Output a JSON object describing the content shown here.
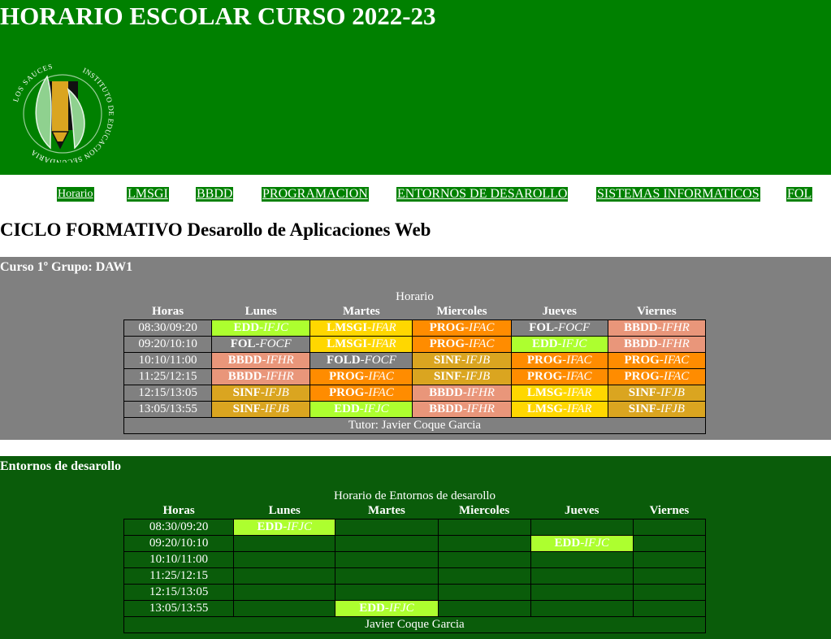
{
  "header": {
    "title": "HORARIO ESCOLAR CURSO 2022-23",
    "logo": {
      "text_top": "LOS SAUCES",
      "text_ring": "INSTITUTO DE EDUCACION SECUNDARIA"
    }
  },
  "nav": [
    "Horario",
    "LMSGI",
    "BBDD",
    "PROGRAMACION",
    "ENTORNOS DE DESAROLLO",
    "SISTEMAS INFORMATICOS",
    "FOL"
  ],
  "ciclo": "CICLO FORMATIVO Desarollo de Aplicaciones Web",
  "grupo": {
    "title": "Curso 1º Grupo: DAW1",
    "caption": "Horario",
    "headers": [
      "Horas",
      "Lunes",
      "Martes",
      "Miercoles",
      "Jueves",
      "Viernes"
    ],
    "rows": [
      {
        "time": "08:30/09:20",
        "cells": [
          [
            "EDD",
            "-IFJC",
            "edd"
          ],
          [
            "LMSGI",
            "-IFAR",
            "lmsgi"
          ],
          [
            "PROG",
            "-IFAC",
            "prog"
          ],
          [
            "FOL",
            "-FOCF",
            "fol"
          ],
          [
            "BBDD",
            "-IFHR",
            "bbdd"
          ]
        ]
      },
      {
        "time": "09:20/10:10",
        "cells": [
          [
            "FOL",
            "-FOCF",
            "fol"
          ],
          [
            "LMSGI",
            "-IFAR",
            "lmsgi"
          ],
          [
            "PROG",
            "-IFAC",
            "prog"
          ],
          [
            "EDD",
            "-IFJC",
            "edd"
          ],
          [
            "BBDD",
            "-IFHR",
            "bbdd"
          ]
        ]
      },
      {
        "time": "10:10/11:00",
        "cells": [
          [
            "BBDD",
            "-IFHR",
            "bbdd"
          ],
          [
            "FOLD",
            "-FOCF",
            "fol"
          ],
          [
            "SINF",
            "-IFJB",
            "sinf"
          ],
          [
            "PROG",
            "-IFAC",
            "prog"
          ],
          [
            "PROG",
            "-IFAC",
            "prog"
          ]
        ]
      },
      {
        "time": "11:25/12:15",
        "cells": [
          [
            "BBDD",
            "-IFHR",
            "bbdd"
          ],
          [
            "PROG",
            "-IFAC",
            "prog"
          ],
          [
            "SINF",
            "-IFJB",
            "sinf"
          ],
          [
            "PROG",
            "-IFAC",
            "prog"
          ],
          [
            "PROG",
            "-IFAC",
            "prog"
          ]
        ]
      },
      {
        "time": "12:15/13:05",
        "cells": [
          [
            "SINF",
            "-IFJB",
            "sinf"
          ],
          [
            "PROG",
            "-IFAC",
            "prog"
          ],
          [
            "BBDD",
            "-IFHR",
            "bbdd"
          ],
          [
            "LMSG",
            "-IFAR",
            "lmsgi"
          ],
          [
            "SINF",
            "-IFJB",
            "sinf"
          ]
        ]
      },
      {
        "time": "13:05/13:55",
        "cells": [
          [
            "SINF",
            "-IFJB",
            "sinf"
          ],
          [
            "EDD",
            "-IFJC",
            "edd"
          ],
          [
            "BBDD",
            "-IFHR",
            "bbdd"
          ],
          [
            "LMSG",
            "-IFAR",
            "lmsgi"
          ],
          [
            "SINF",
            "-IFJB",
            "sinf"
          ]
        ]
      }
    ],
    "footer": "Tutor: Javier Coque Garcia"
  },
  "entornos": {
    "title": "Entornos de desarollo",
    "caption": "Horario de Entornos de desarollo",
    "headers": [
      "Horas",
      "Lunes",
      "Martes",
      "Miercoles",
      "Jueves",
      "Viernes"
    ],
    "rows": [
      {
        "time": "08:30/09:20",
        "cells": [
          [
            "EDD",
            "-IFJC",
            "edd"
          ],
          null,
          null,
          null,
          null
        ]
      },
      {
        "time": "09:20/10:10",
        "cells": [
          null,
          null,
          null,
          [
            "EDD",
            "-IFJC",
            "edd"
          ],
          null
        ]
      },
      {
        "time": "10:10/11:00",
        "cells": [
          null,
          null,
          null,
          null,
          null
        ]
      },
      {
        "time": "11:25/12:15",
        "cells": [
          null,
          null,
          null,
          null,
          null
        ]
      },
      {
        "time": "12:15/13:05",
        "cells": [
          null,
          null,
          null,
          null,
          null
        ]
      },
      {
        "time": "13:05/13:55",
        "cells": [
          null,
          [
            "EDD",
            "-IFJC",
            "edd"
          ],
          null,
          null,
          null
        ]
      }
    ],
    "footer": "Javier Coque Garcia"
  }
}
